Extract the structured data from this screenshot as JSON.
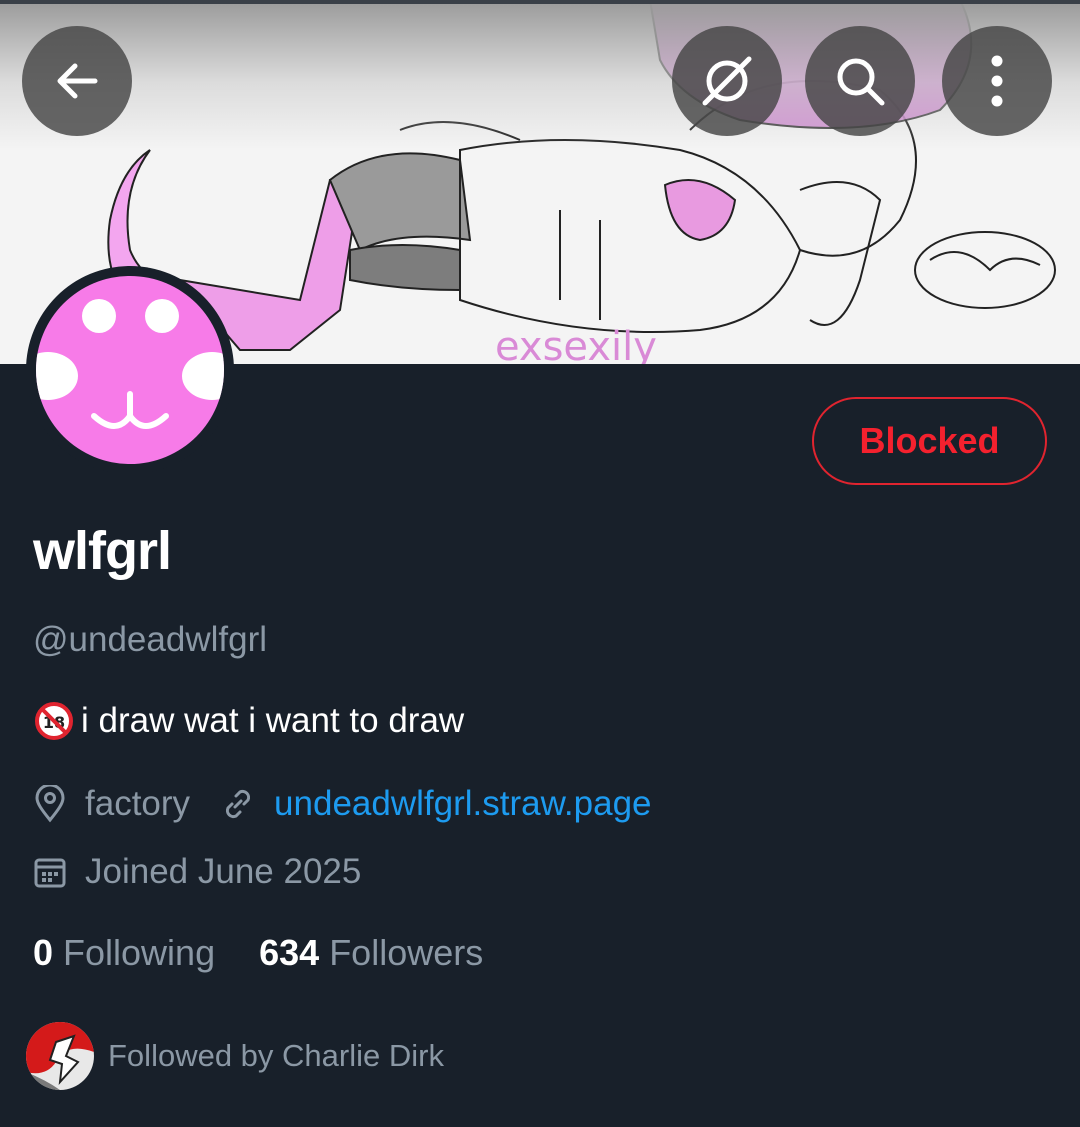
{
  "header": {
    "back_icon": "arrow-left-icon",
    "grok_icon": "grok-icon",
    "search_icon": "search-icon",
    "more_icon": "more-vertical-icon"
  },
  "banner": {
    "signature": "exsexily"
  },
  "profile": {
    "blocked_label": "Blocked",
    "display_name": "wlfgrl",
    "handle": "@undeadwlfgrl",
    "bio_emoji_icon": "no-under-18-icon",
    "bio": "i draw wat i want to draw",
    "location": "factory",
    "website": "undeadwlfgrl.straw.page",
    "joined": "Joined June 2025",
    "following_count": "0",
    "following_label": "Following",
    "followers_count": "634",
    "followers_label": "Followers",
    "followed_by": "Followed by Charlie Dirk"
  },
  "colors": {
    "background": "#18202a",
    "accent_link": "#1d9bf0",
    "blocked_red": "#f4212e",
    "muted_text": "#8b98a5",
    "avatar_pink": "#f77be8"
  }
}
